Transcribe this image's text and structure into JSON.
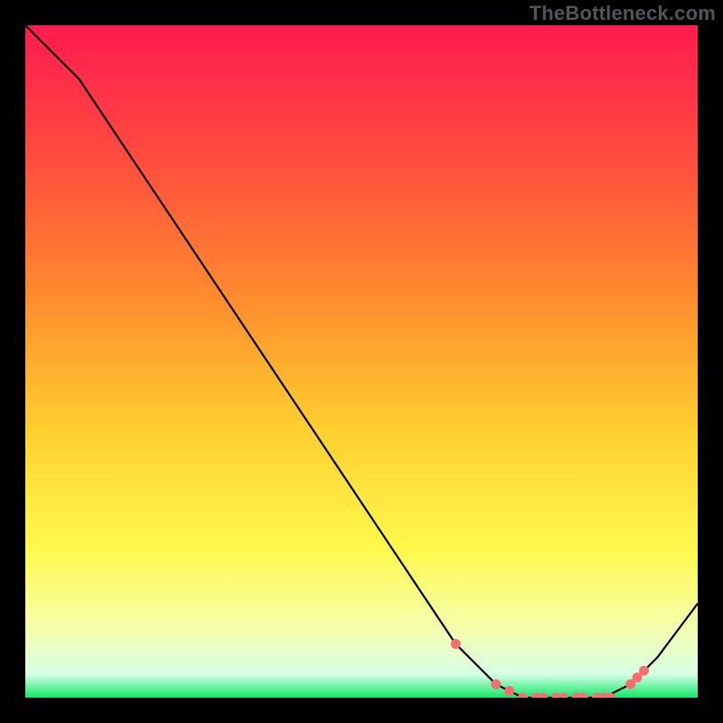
{
  "watermark": "TheBottleneck.com",
  "chart_data": {
    "type": "line",
    "title": "",
    "xlabel": "",
    "ylabel": "",
    "xlim": [
      0,
      100
    ],
    "ylim": [
      0,
      100
    ],
    "grid": false,
    "series": [
      {
        "name": "curve",
        "x": [
          0,
          8,
          16,
          24,
          32,
          40,
          48,
          56,
          64,
          70,
          74,
          78,
          82,
          86,
          90,
          94,
          100
        ],
        "y": [
          100,
          92,
          80,
          68,
          56,
          44,
          32,
          20,
          8,
          2,
          0,
          0,
          0,
          0,
          2,
          6,
          14
        ]
      }
    ],
    "markers": {
      "name": "dots",
      "color": "#f76e6e",
      "x": [
        64,
        70,
        72,
        74,
        76,
        77,
        79,
        80,
        82,
        83,
        85,
        86,
        87,
        90,
        91,
        92
      ],
      "y": [
        8,
        2,
        1,
        0,
        0,
        0,
        0,
        0,
        0,
        0,
        0,
        0,
        0,
        2,
        3,
        4
      ]
    },
    "gradient_stops": [
      {
        "offset": 0.0,
        "color": "#ff1a4f"
      },
      {
        "offset": 0.2,
        "color": "#ff4d3f"
      },
      {
        "offset": 0.4,
        "color": "#ff8a2e"
      },
      {
        "offset": 0.6,
        "color": "#ffcf2f"
      },
      {
        "offset": 0.78,
        "color": "#fff94d"
      },
      {
        "offset": 0.9,
        "color": "#f3ffb0"
      },
      {
        "offset": 0.965,
        "color": "#d7ffe6"
      },
      {
        "offset": 1.0,
        "color": "#12e867"
      }
    ]
  }
}
